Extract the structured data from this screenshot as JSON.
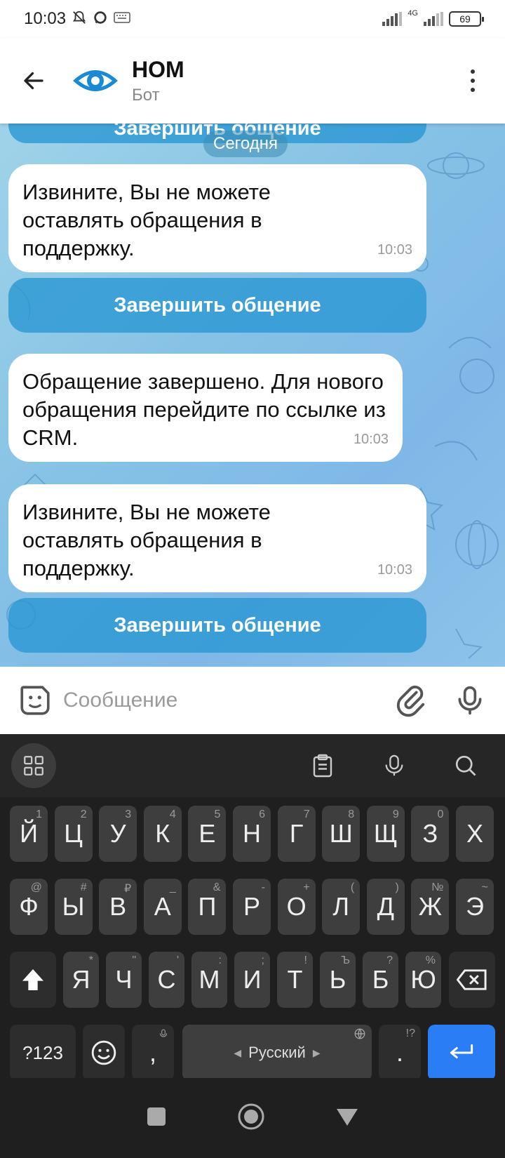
{
  "status_bar": {
    "time": "10:03",
    "network": "4G",
    "battery": "69",
    "icons": [
      "mute-icon",
      "chat-icon",
      "keyboard-icon",
      "signal-icon",
      "signal-4g-icon",
      "battery-icon"
    ]
  },
  "header": {
    "title": "НОМ",
    "subtitle": "Бот",
    "icons": [
      "back-arrow-icon",
      "eye-logo-icon",
      "more-vertical-icon"
    ]
  },
  "chat": {
    "top_button": "Завершить общение",
    "date_label": "Сегодня",
    "messages": [
      {
        "text": "Извините, Вы не можете оставлять обращения в поддержку.",
        "time": "10:03",
        "button": "Завершить общение"
      },
      {
        "text": "Обращение завершено. Для нового обращения перейдите по ссылке из CRM.",
        "time": "10:03"
      },
      {
        "text": "Извините, Вы не можете оставлять обращения в поддержку.",
        "time": "10:03",
        "button": "Завершить общение"
      }
    ]
  },
  "composer": {
    "placeholder": "Сообщение",
    "icons": [
      "sticker-icon",
      "paperclip-icon",
      "microphone-icon"
    ]
  },
  "keyboard": {
    "toolbar_icons": [
      "apps-grid-icon",
      "clipboard-icon",
      "voice-input-icon",
      "search-icon"
    ],
    "row1": [
      [
        "Й",
        "1"
      ],
      [
        "Ц",
        "2"
      ],
      [
        "У",
        "3"
      ],
      [
        "К",
        "4"
      ],
      [
        "Е",
        "5"
      ],
      [
        "Н",
        "6"
      ],
      [
        "Г",
        "7"
      ],
      [
        "Ш",
        "8"
      ],
      [
        "Щ",
        "9"
      ],
      [
        "З",
        "0"
      ],
      [
        "Х",
        ""
      ]
    ],
    "row2": [
      [
        "Ф",
        "@"
      ],
      [
        "Ы",
        "#"
      ],
      [
        "В",
        "₽"
      ],
      [
        "А",
        "_"
      ],
      [
        "П",
        "&"
      ],
      [
        "Р",
        "-"
      ],
      [
        "О",
        "+"
      ],
      [
        "Л",
        "("
      ],
      [
        "Д",
        ")"
      ],
      [
        "Ж",
        "№"
      ],
      [
        "Э",
        "~"
      ]
    ],
    "row3": [
      [
        "Я",
        "*"
      ],
      [
        "Ч",
        "\""
      ],
      [
        "С",
        "'"
      ],
      [
        "М",
        ":"
      ],
      [
        "И",
        ";"
      ],
      [
        "Т",
        "!"
      ],
      [
        "Ь",
        "Ъ"
      ],
      [
        "Б",
        "?"
      ],
      [
        "Ю",
        "%"
      ]
    ],
    "symbols_key": "?123",
    "comma_key": ",",
    "space_label": "Русский",
    "period_key": ".",
    "period_sup": "!?"
  },
  "navbar": {
    "icons": [
      "recents-square-icon",
      "home-circle-icon",
      "back-triangle-icon"
    ]
  }
}
